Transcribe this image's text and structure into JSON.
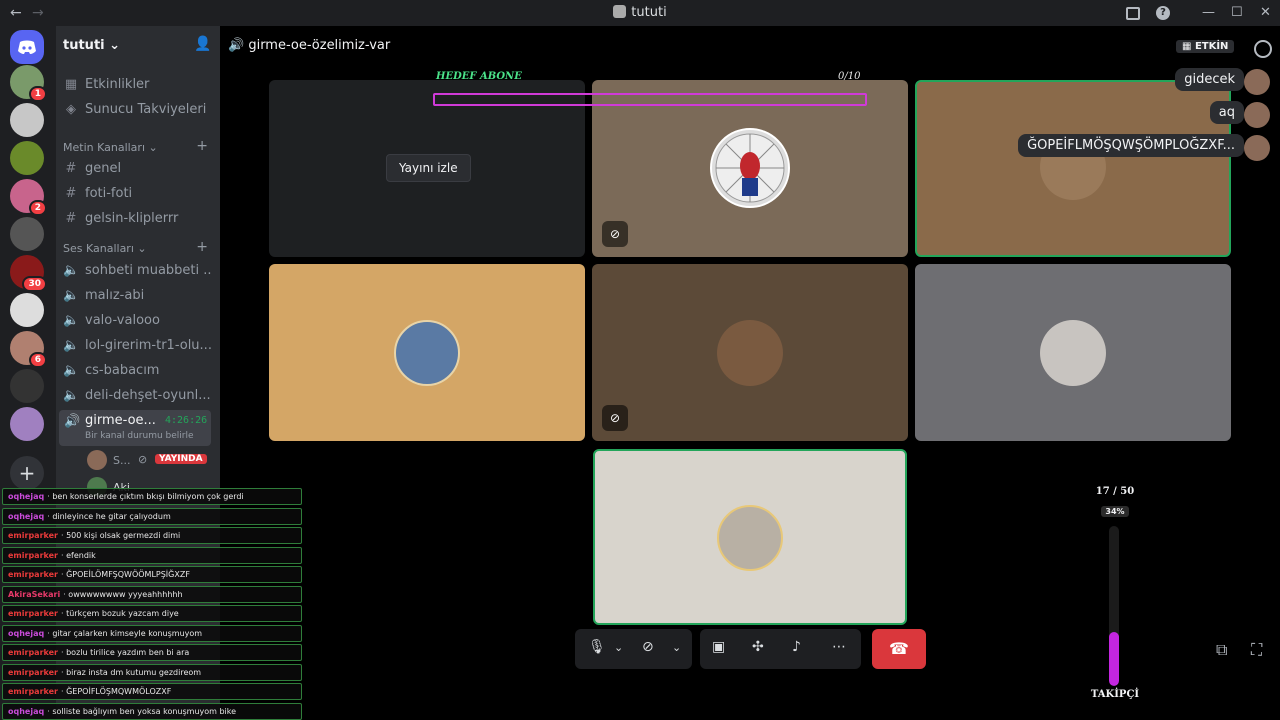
{
  "window": {
    "title": "tututi",
    "back": "←",
    "forward": "→",
    "minimize": "—",
    "maximize": "☐",
    "close": "✕",
    "inbox_icon": "inbox-icon",
    "help_icon": "?"
  },
  "guilds": [
    {
      "color": "#7a9a6a",
      "badge": "1"
    },
    {
      "color": "#c7c7c7",
      "badge": ""
    },
    {
      "color": "#6a8a2a",
      "badge": ""
    },
    {
      "color": "#c8648c",
      "badge": "2"
    },
    {
      "color": "#555555",
      "badge": ""
    },
    {
      "color": "#8a1a1a",
      "badge": "30"
    },
    {
      "color": "#dddddd",
      "badge": ""
    },
    {
      "color": "#b08070",
      "badge": "6"
    },
    {
      "color": "#333333",
      "badge": ""
    },
    {
      "color": "#a080c0",
      "badge": ""
    }
  ],
  "sidebar": {
    "server_name": "tututi",
    "events": "Etkinlikler",
    "boosts": "Sunucu Takviyeleri",
    "text_category": "Metin Kanalları",
    "text_channels": [
      "genel",
      "foti-foti",
      "gelsin-kliplerrr"
    ],
    "voice_category": "Ses Kanalları",
    "voice_channels": [
      "sohbeti muabbeti ...",
      "malız-abi",
      "valo-valooo",
      "lol-girerim-tr1-olu...",
      "cs-babacım",
      "deli-dehşet-oyunl..."
    ],
    "active_channel": "girme-oe...",
    "active_timer": "4:26:26",
    "active_status": "Bir kanal durumu belirle",
    "voice_user1": "S...",
    "live_badge": "YAYINDA",
    "voice_user2": "Aki"
  },
  "main": {
    "channel_title": "girme-oe-özelimiz-var",
    "event_button": "ETKİN",
    "goal_label": "HEDEF ABONE",
    "goal_count": "0/10",
    "goal_fraction": 0.0,
    "watch_stream": "Yayını izle",
    "messages": [
      "gidecek",
      "aq",
      "ĞOPEİFLMÖŞQWŞÖMPLOĞZXF..."
    ]
  },
  "chat": [
    {
      "user": "oqhejaq",
      "color": "#c84bd8",
      "text": "ben konserlerde çıktım bkışı bilmiyom çok gerdi"
    },
    {
      "user": "oqhejaq",
      "color": "#c84bd8",
      "text": "dinleyince he gitar çalıyodum"
    },
    {
      "user": "emirparker",
      "color": "#e83a3a",
      "text": "500 kişi olsak germezdi dimi"
    },
    {
      "user": "emirparker",
      "color": "#e83a3a",
      "text": "efendik"
    },
    {
      "user": "emirparker",
      "color": "#e83a3a",
      "text": "ĞPOEİLÖMFŞQWÖÖMLPŞİĞXZF"
    },
    {
      "user": "AkiraSekari",
      "color": "#e83a6a",
      "text": "owwwwwwww yyyeahhhhhh"
    },
    {
      "user": "emirparker",
      "color": "#e83a3a",
      "text": "türkçem bozuk yazcam diye"
    },
    {
      "user": "oqhejaq",
      "color": "#c84bd8",
      "text": "gitar çalarken kimseyle konuşmuyom"
    },
    {
      "user": "emirparker",
      "color": "#e83a3a",
      "text": "bozlu tirilice yazdım ben bi ara"
    },
    {
      "user": "emirparker",
      "color": "#e83a3a",
      "text": "biraz insta dm kutumu gezdireom"
    },
    {
      "user": "emirparker",
      "color": "#e83a3a",
      "text": "ĞEPOİFLÖŞMQWMÖLOZXF"
    },
    {
      "user": "oqhejaq",
      "color": "#c84bd8",
      "text": "solliste bağlıyım ben yoksa konuşmuyom bike"
    }
  ],
  "follower_goal": {
    "count": "17 / 50",
    "percent": "34%",
    "fraction": 0.34,
    "label": "TAKİPÇİ"
  }
}
